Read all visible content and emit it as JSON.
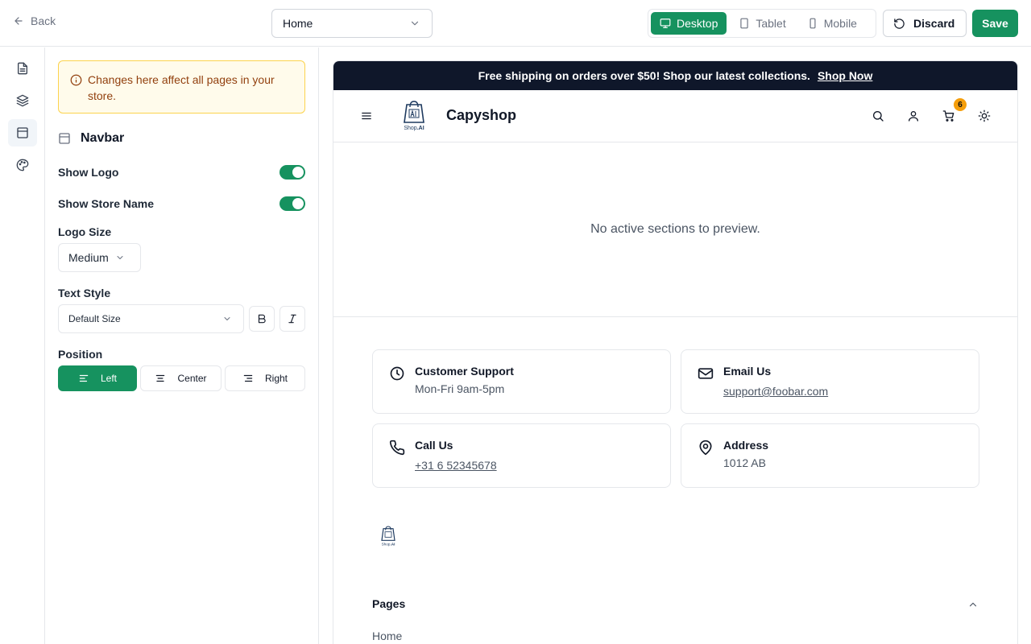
{
  "topbar": {
    "back_label": "Back",
    "page_select_value": "Home",
    "devices": [
      "Desktop",
      "Tablet",
      "Mobile"
    ],
    "active_device": "Desktop",
    "discard_label": "Discard",
    "save_label": "Save"
  },
  "rail": {
    "items": [
      "pages-icon",
      "layers-icon",
      "layout-icon",
      "palette-icon"
    ],
    "active": "layout-icon"
  },
  "panel": {
    "notice": "Changes here affect all pages in your store.",
    "section_title": "Navbar",
    "show_logo_label": "Show Logo",
    "show_logo_on": true,
    "show_store_name_label": "Show Store Name",
    "show_store_name_on": true,
    "logo_size_label": "Logo Size",
    "logo_size_value": "Medium",
    "text_style_label": "Text Style",
    "text_style_value": "Default Size",
    "position_label": "Position",
    "position_options": [
      "Left",
      "Center",
      "Right"
    ],
    "position_active": "Left"
  },
  "preview": {
    "promo_text": "Free shipping on orders over $50! Shop our latest collections.",
    "promo_link": "Shop Now",
    "store_name": "Capyshop",
    "cart_count": "6",
    "empty_message": "No active sections to preview.",
    "contact_cards": [
      {
        "title": "Customer Support",
        "sub": "Mon-Fri 9am-5pm",
        "icon": "clock-icon"
      },
      {
        "title": "Email Us",
        "sub": "support@foobar.com",
        "icon": "mail-icon"
      },
      {
        "title": "Call Us",
        "sub": "+31 6 52345678",
        "icon": "phone-icon"
      },
      {
        "title": "Address",
        "sub": "1012 AB",
        "icon": "map-pin-icon"
      }
    ],
    "pages_heading": "Pages",
    "pages_items": [
      "Home"
    ]
  },
  "colors": {
    "accent": "#16925f",
    "promo_bg": "#0f172a",
    "notice_bg": "#fffbeb",
    "notice_text": "#92400e",
    "badge": "#f59e0b"
  }
}
